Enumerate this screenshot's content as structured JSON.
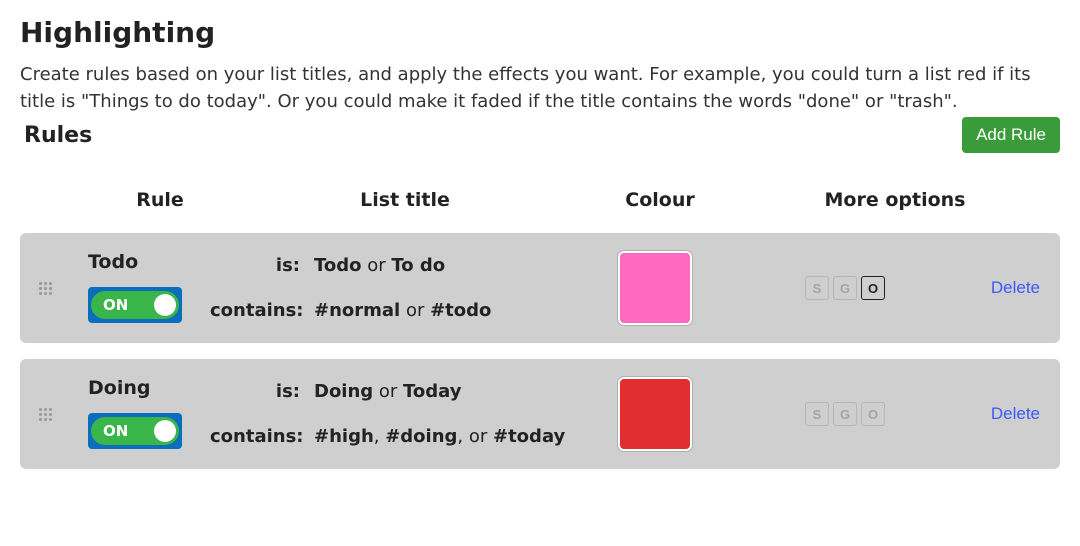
{
  "page_title": "Highlighting",
  "intro": "Create rules based on your list titles, and apply the effects you want. For example, you could turn a list red if its title is \"Things to do today\". Or you could make it faded if the title contains the words \"done\" or \"trash\".",
  "rules_label": "Rules",
  "add_rule_label": "Add Rule",
  "columns": {
    "rule": "Rule",
    "list_title": "List title",
    "colour": "Colour",
    "more": "More options"
  },
  "toggle_on_label": "ON",
  "option_letters": {
    "s": "S",
    "g": "G",
    "o": "O"
  },
  "delete_label": "Delete",
  "keys": {
    "is": "is:",
    "contains": "contains:"
  },
  "rules": [
    {
      "name": "Todo",
      "enabled": true,
      "is_html": "<b>Todo</b> or <b>To do</b>",
      "contains_html": "<b>#normal</b> or <b>#todo</b>",
      "colour": "#ff69c0",
      "options": {
        "s": false,
        "g": false,
        "o": true
      }
    },
    {
      "name": "Doing",
      "enabled": true,
      "is_html": "<b>Doing</b> or <b>Today</b>",
      "contains_html": "<b>#high</b>, <b>#doing</b>, or <b>#today</b>",
      "colour": "#e22e2e",
      "options": {
        "s": false,
        "g": false,
        "o": false
      }
    }
  ]
}
